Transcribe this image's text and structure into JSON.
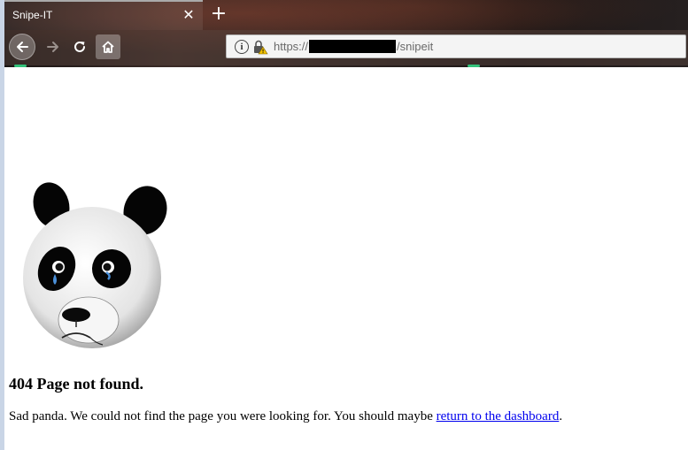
{
  "browser": {
    "tab": {
      "title": "Snipe-IT",
      "close_icon": "close-icon"
    },
    "new_tab_icon": "plus-icon",
    "nav": {
      "back_icon": "arrow-left-icon",
      "forward_icon": "arrow-right-icon",
      "reload_icon": "reload-icon",
      "home_icon": "home-icon"
    },
    "address_bar": {
      "info_icon": "info-icon",
      "lock_icon": "lock-warning-icon",
      "url_prefix": "https://",
      "url_suffix": "/snipeit"
    }
  },
  "page": {
    "image": "sad-panda-image",
    "heading": "404 Page not found.",
    "message_before": "Sad panda. We could not find the page you were looking for. You should maybe ",
    "link_text": "return to the dashboard",
    "message_after": "."
  },
  "colors": {
    "link": "#0000ee",
    "text": "#000000",
    "chrome_dark": "#1a1514",
    "accent": "#33c27a"
  }
}
